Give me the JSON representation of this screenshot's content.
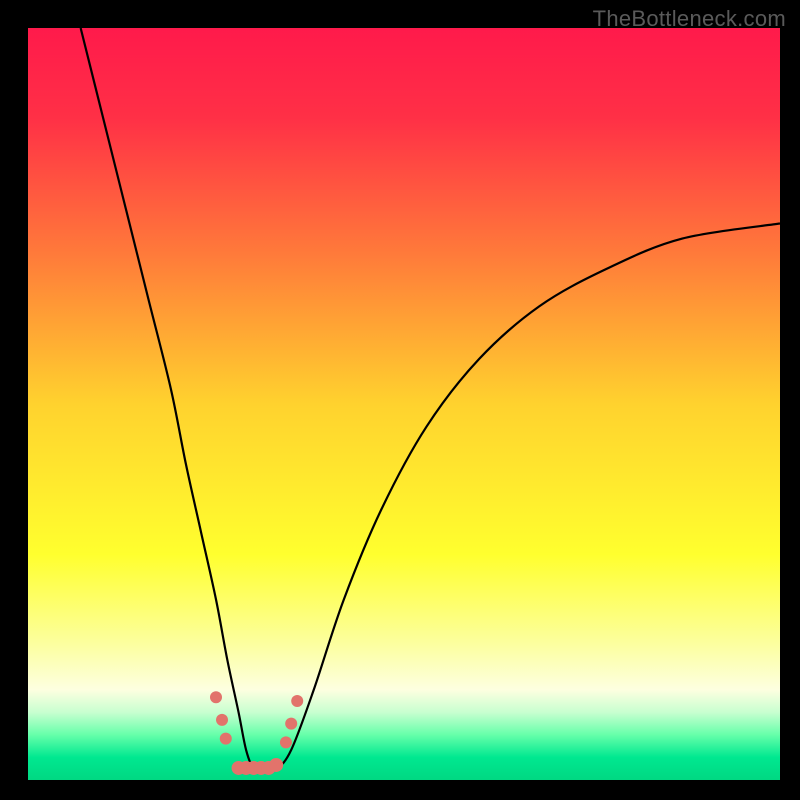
{
  "watermark": "TheBottleneck.com",
  "chart_data": {
    "type": "line",
    "title": "",
    "xlabel": "",
    "ylabel": "",
    "xlim": [
      0,
      100
    ],
    "ylim": [
      0,
      100
    ],
    "background_gradient": {
      "stops": [
        {
          "pos": 0.0,
          "color": "#ff1a4b"
        },
        {
          "pos": 0.12,
          "color": "#ff3046"
        },
        {
          "pos": 0.3,
          "color": "#ff7a3a"
        },
        {
          "pos": 0.5,
          "color": "#ffd22e"
        },
        {
          "pos": 0.7,
          "color": "#ffff2e"
        },
        {
          "pos": 0.82,
          "color": "#fcffa0"
        },
        {
          "pos": 0.88,
          "color": "#fdffe0"
        },
        {
          "pos": 0.91,
          "color": "#c8ffd0"
        },
        {
          "pos": 0.94,
          "color": "#66ffaa"
        },
        {
          "pos": 0.97,
          "color": "#00e890"
        },
        {
          "pos": 1.0,
          "color": "#00d882"
        }
      ]
    },
    "series": [
      {
        "name": "bottleneck-curve",
        "color": "#000000",
        "x": [
          7,
          10,
          13,
          16,
          19,
          21,
          23,
          25,
          26.5,
          28,
          29,
          30,
          31,
          33,
          35,
          38,
          42,
          47,
          53,
          60,
          68,
          77,
          87,
          100
        ],
        "y": [
          100,
          88,
          76,
          64,
          52,
          42,
          33,
          24,
          16,
          9,
          4,
          1.5,
          1.5,
          1.5,
          4,
          12,
          24,
          36,
          47,
          56,
          63,
          68,
          72,
          74
        ]
      }
    ],
    "markers": {
      "name": "highlight-dots",
      "color": "#e2736b",
      "x": [
        25.0,
        25.8,
        26.3,
        28.0,
        29.0,
        30.0,
        31.0,
        32.0,
        33.0,
        34.3,
        35.0,
        35.8
      ],
      "y": [
        11.0,
        8.0,
        5.5,
        1.6,
        1.6,
        1.6,
        1.6,
        1.6,
        2.0,
        5.0,
        7.5,
        10.5
      ],
      "radius": [
        6,
        6,
        6,
        7,
        7,
        7,
        7,
        7,
        7,
        6,
        6,
        6
      ]
    }
  }
}
